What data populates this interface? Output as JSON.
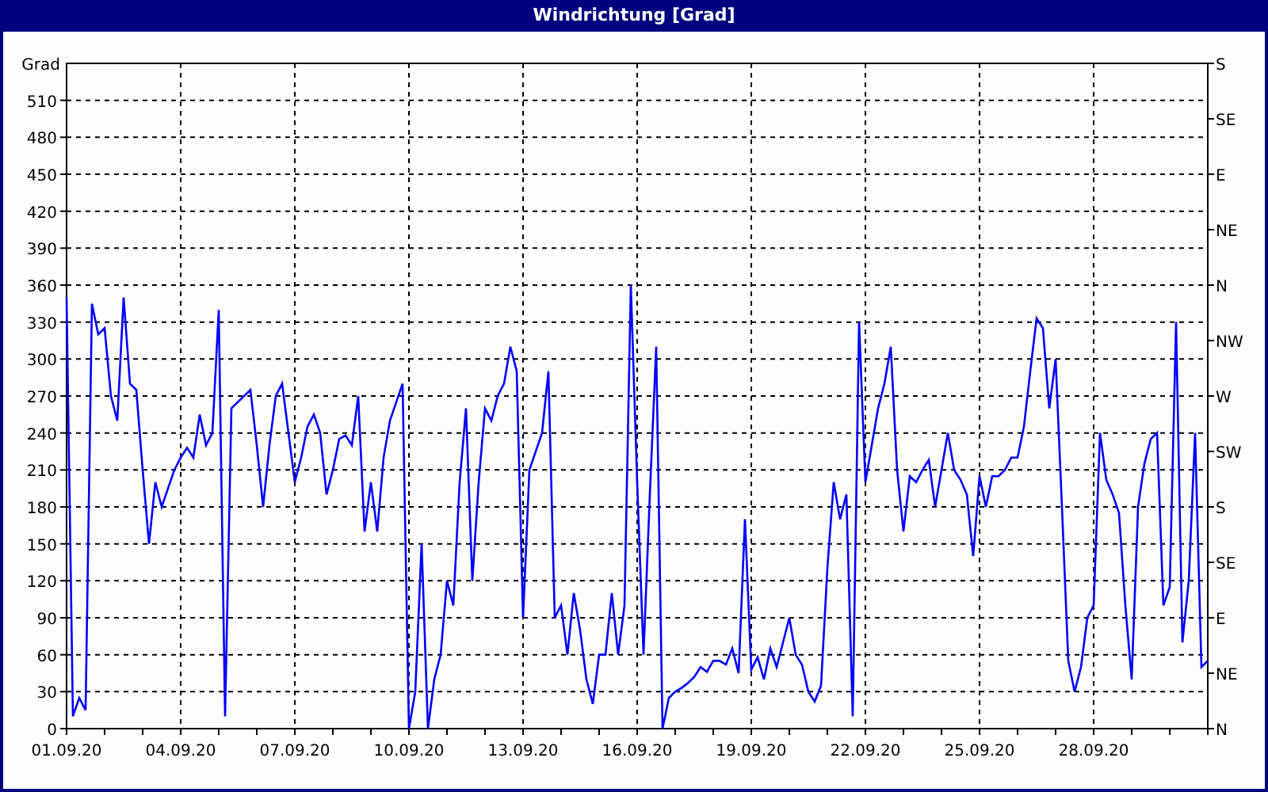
{
  "window": {
    "title": "Windrichtung [Grad]"
  },
  "chart": {
    "chart_data": {
      "type": "line",
      "grid": true,
      "ylabel": "Grad",
      "ylim": [
        0,
        540
      ],
      "yticks": [
        0,
        30,
        60,
        90,
        120,
        150,
        180,
        210,
        240,
        270,
        300,
        330,
        360,
        390,
        420,
        450,
        480,
        510
      ],
      "categories": [
        "01.09.20",
        null,
        null,
        null,
        null,
        null,
        null,
        null,
        null,
        null,
        null,
        null,
        null,
        null,
        null,
        null,
        null,
        null,
        "04.09.20",
        null,
        null,
        null,
        null,
        null,
        null,
        null,
        null,
        null,
        null,
        null,
        null,
        null,
        null,
        null,
        null,
        null,
        "07.09.20",
        null,
        null,
        null,
        null,
        null,
        null,
        null,
        null,
        null,
        null,
        null,
        null,
        null,
        null,
        null,
        null,
        null,
        "10.09.20",
        null,
        null,
        null,
        null,
        null,
        null,
        null,
        null,
        null,
        null,
        null,
        null,
        null,
        null,
        null,
        null,
        null,
        "13.09.20",
        null,
        null,
        null,
        null,
        null,
        null,
        null,
        null,
        null,
        null,
        null,
        null,
        null,
        null,
        null,
        null,
        null,
        "16.09.20",
        null,
        null,
        null,
        null,
        null,
        null,
        null,
        null,
        null,
        null,
        null,
        null,
        null,
        null,
        null,
        null,
        null,
        "19.09.20",
        null,
        null,
        null,
        null,
        null,
        null,
        null,
        null,
        null,
        null,
        null,
        null,
        null,
        null,
        null,
        null,
        null,
        "22.09.20",
        null,
        null,
        null,
        null,
        null,
        null,
        null,
        null,
        null,
        null,
        null,
        null,
        null,
        null,
        null,
        null,
        null,
        "25.09.20",
        null,
        null,
        null,
        null,
        null,
        null,
        null,
        null,
        null,
        null,
        null,
        null,
        null,
        null,
        null,
        null,
        null,
        "28.09.20",
        null,
        null,
        null,
        null,
        null,
        null,
        null,
        null,
        null,
        null,
        null,
        null,
        null,
        null,
        null,
        null,
        null,
        null
      ],
      "series": [
        {
          "color": "#0000ff",
          "values": [
            350,
            10,
            25,
            15,
            345,
            320,
            325,
            270,
            250,
            350,
            280,
            275,
            210,
            150,
            200,
            180,
            195,
            210,
            220,
            228,
            220,
            255,
            230,
            240,
            340,
            10,
            260,
            265,
            270,
            275,
            230,
            180,
            230,
            270,
            280,
            240,
            200,
            220,
            245,
            255,
            240,
            190,
            210,
            235,
            238,
            230,
            270,
            160,
            200,
            160,
            220,
            250,
            265,
            280,
            0,
            30,
            150,
            0,
            40,
            60,
            120,
            100,
            200,
            260,
            120,
            200,
            260,
            250,
            270,
            280,
            310,
            290,
            90,
            210,
            225,
            240,
            290,
            90,
            100,
            60,
            110,
            80,
            40,
            20,
            60,
            60,
            110,
            60,
            100,
            360,
            200,
            60,
            190,
            310,
            0,
            25,
            30,
            33,
            37,
            42,
            50,
            46,
            55,
            55,
            52,
            65,
            45,
            170,
            48,
            58,
            40,
            65,
            50,
            70,
            90,
            60,
            52,
            30,
            22,
            35,
            130,
            200,
            170,
            190,
            10,
            330,
            200,
            230,
            260,
            280,
            310,
            210,
            160,
            205,
            200,
            210,
            218,
            180,
            210,
            240,
            210,
            202,
            190,
            140,
            205,
            180,
            205,
            205,
            210,
            220,
            220,
            245,
            290,
            333,
            325,
            260,
            300,
            180,
            55,
            30,
            50,
            90,
            100,
            240,
            202,
            190,
            175,
            100,
            40,
            180,
            215,
            235,
            240,
            100,
            115,
            330,
            70,
            120,
            240,
            50,
            55
          ]
        }
      ]
    }
  },
  "right_axis": {
    "labels": [
      "S",
      "SE",
      "E",
      "NE",
      "N",
      "NW",
      "W",
      "SW",
      "S",
      "SE",
      "E",
      "NE",
      "N"
    ]
  }
}
